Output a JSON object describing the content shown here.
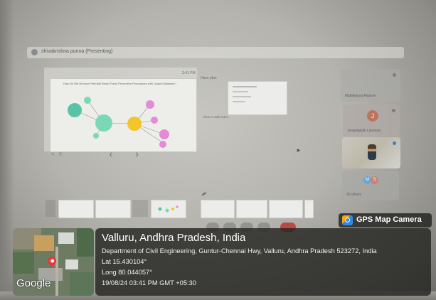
{
  "meet": {
    "presenter_bar": "shivakrishna punna (Presenting)",
    "slide_time": "3:41 PM",
    "notes_title": "Have plan",
    "notes_hint": "Click to add notes",
    "slide_heading": "How Do We Reduce Potential Risks Posed Preventive Procedures with Graph Database?"
  },
  "participants": [
    {
      "name": "Mallakayya Aharom"
    },
    {
      "name": "Jangalapalli Lavanya",
      "initial": "J"
    },
    {
      "name": ""
    },
    {
      "name": "20 others",
      "initials": [
        "M",
        "S"
      ]
    }
  ],
  "gps": {
    "badge": "GPS Map Camera",
    "place": "Valluru, Andhra Pradesh, India",
    "address": "Department of Civil Engineering, Guntur-Chennai Hwy, Valluru, Andhra Pradesh 523272, India",
    "lat": "Lat 15.430104°",
    "long": "Long 80.044057°",
    "datetime": "19/08/24 03:41 PM GMT +05:30",
    "map_brand": "Google",
    "pin_color": "#e53935"
  },
  "colors": {
    "node_teal": "#58c4a6",
    "node_yellow": "#f2c52a",
    "node_pink": "#e58bd6",
    "node_green": "#7bd8b6"
  }
}
